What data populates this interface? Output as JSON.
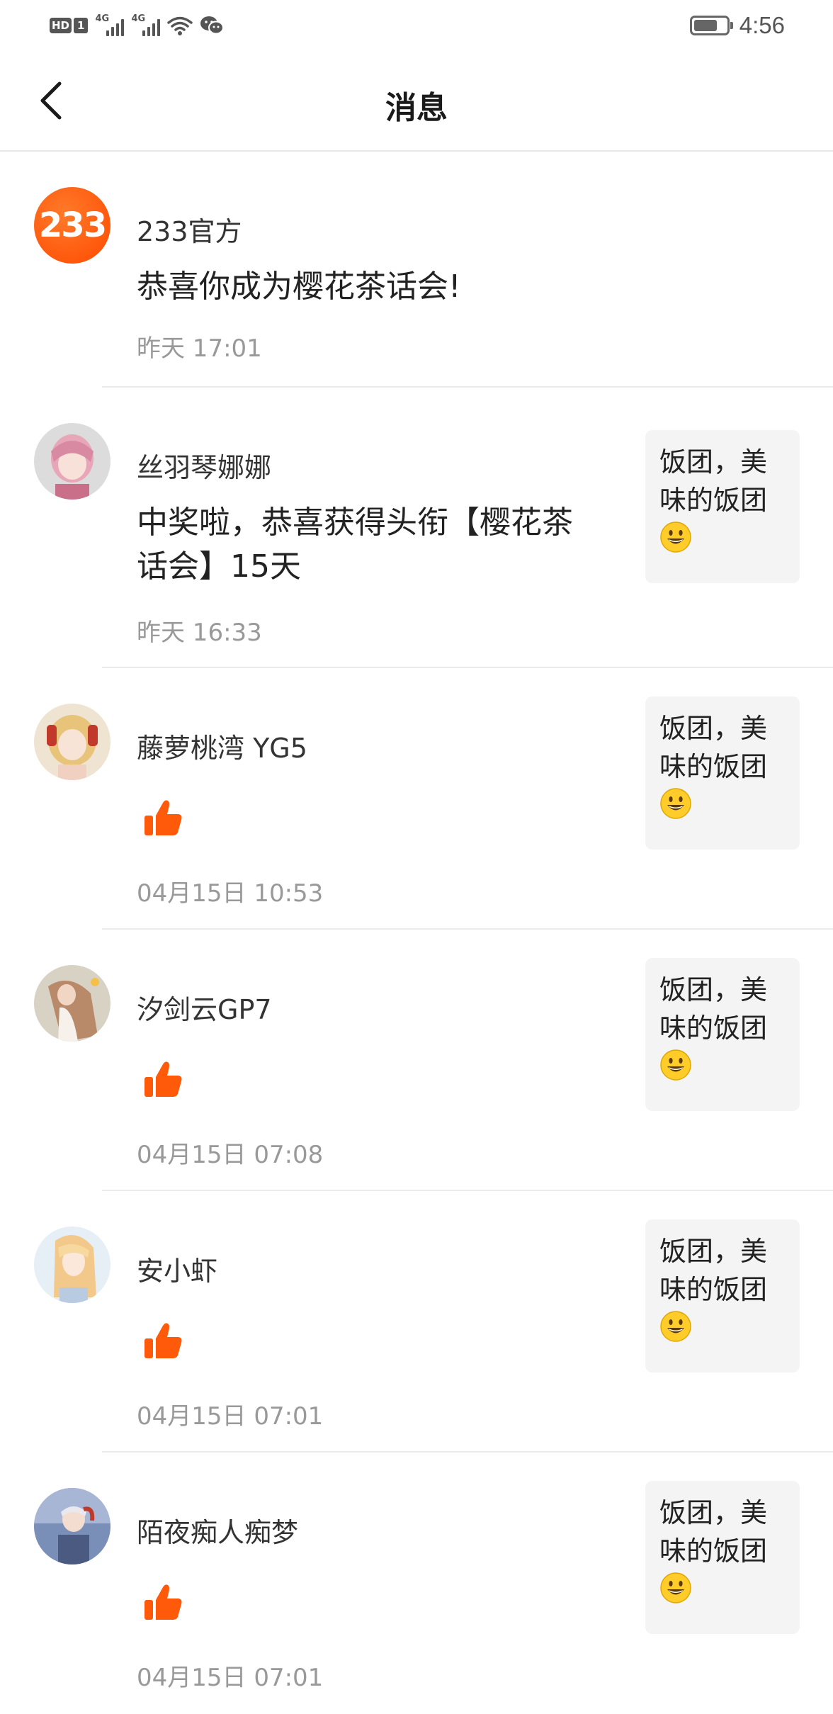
{
  "status_bar": {
    "hd_label": "HD",
    "sim_label": "1",
    "network_1": "4G",
    "network_2": "4G",
    "time": "4:56"
  },
  "nav": {
    "title": "消息"
  },
  "messages": [
    {
      "sender": "233官方",
      "avatar_text": "233",
      "text": "恭喜你成为樱花茶话会!",
      "time": "昨天 17:01",
      "has_quote": false
    },
    {
      "sender": "丝羽琴娜娜",
      "text": "中奖啦，恭喜获得头衔【樱花茶话会】15天",
      "time": "昨天 16:33",
      "quote": "饭团，美味的饭团",
      "avatar_color": "#e8a7b8"
    },
    {
      "sender": "藤萝桃湾 YG5",
      "text": "",
      "like": true,
      "time": "04月15日 10:53",
      "quote": "饭团，美味的饭团",
      "avatar_color": "#e8c37a"
    },
    {
      "sender": "汐剑云GP7",
      "text": "",
      "like": true,
      "time": "04月15日 07:08",
      "quote": "饭团，美味的饭团",
      "avatar_color": "#b98a6a"
    },
    {
      "sender": "安小虾",
      "text": "",
      "like": true,
      "time": "04月15日 07:01",
      "quote": "饭团，美味的饭团",
      "avatar_color": "#f2c98b"
    },
    {
      "sender": "陌夜痴人痴梦",
      "text": "",
      "like": true,
      "time": "04月15日 07:01",
      "quote": "饭团，美味的饭团",
      "avatar_color": "#7a8fb8"
    }
  ],
  "colors": {
    "accent_orange": "#ff5a0a",
    "divider": "#ebebeb",
    "quote_bg": "#f4f4f4",
    "time_gray": "#999999"
  },
  "icons": {
    "back": "chevron-left-icon",
    "like": "thumbs-up-icon",
    "emoji": "grinning-face-icon"
  }
}
